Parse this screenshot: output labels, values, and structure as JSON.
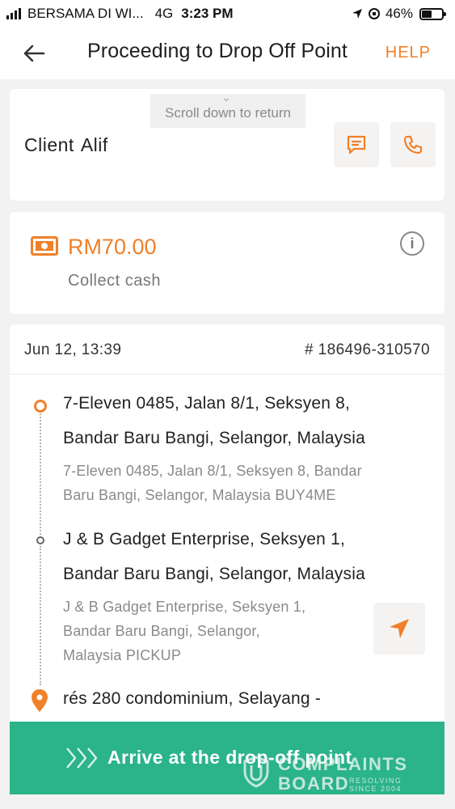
{
  "status_bar": {
    "carrier": "BERSAMA DI WI...",
    "network": "4G",
    "time": "3:23 PM",
    "battery": "46%",
    "battery_level": 0.46
  },
  "header": {
    "title": "Proceeding to Drop Off Point",
    "help": "HELP"
  },
  "scroll_hint": "Scroll down to return",
  "client": {
    "label": "Client",
    "name": "Alif"
  },
  "payment": {
    "amount": "RM70.00",
    "note": "Collect cash"
  },
  "order": {
    "datetime": "Jun 12, 13:39",
    "id": "# 186496-310570"
  },
  "stops": [
    {
      "title_line1": "7-Eleven 0485, Jalan 8/1, Seksyen 8,",
      "title_line2": "Bandar Baru Bangi, Selangor, Malaysia",
      "sub_line1": "7-Eleven 0485, Jalan 8/1, Seksyen 8, Bandar",
      "sub_line2": "Baru Bangi, Selangor, Malaysia  BUY4ME"
    },
    {
      "title_line1": "J & B Gadget Enterprise, Seksyen 1,",
      "title_line2": "Bandar Baru Bangi, Selangor, Malaysia",
      "sub_line1": "J & B Gadget Enterprise, Seksyen 1,",
      "sub_line2": "Bandar Baru Bangi, Selangor,",
      "sub_line3": "Malaysia  PICKUP"
    },
    {
      "title_line1": "rés 280 condominium, Selayang -"
    }
  ],
  "action": {
    "label": "Arrive at the drop-off point"
  },
  "watermark": {
    "line1": "COMPLAINTS",
    "line2": "BOARD",
    "side1": "RESOLVING",
    "side2": "SINCE 2004"
  },
  "colors": {
    "accent": "#f0802a",
    "action": "#2bb389"
  },
  "icons": [
    "back-arrow-icon",
    "chat-icon",
    "phone-icon",
    "cash-icon",
    "info-icon",
    "navigate-icon",
    "location-pin-icon",
    "chevrons-right-icon"
  ]
}
